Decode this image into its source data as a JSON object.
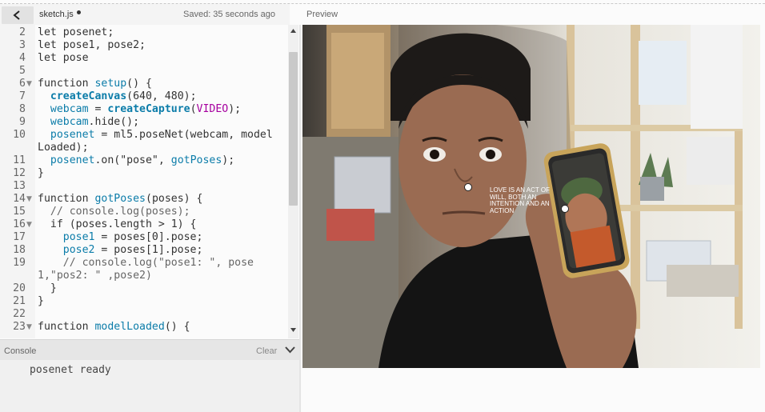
{
  "editor": {
    "file_name": "sketch.js",
    "saved_status": "Saved: 35 seconds ago",
    "code_lines": [
      {
        "n": "2",
        "fold": false,
        "segments": [
          {
            "t": "let posenet;",
            "c": "c-kw"
          }
        ]
      },
      {
        "n": "3",
        "fold": false,
        "segments": [
          {
            "t": "let pose1, pose2;",
            "c": "c-kw"
          }
        ]
      },
      {
        "n": "4",
        "fold": false,
        "segments": [
          {
            "t": "let pose",
            "c": "c-kw"
          }
        ]
      },
      {
        "n": "5",
        "fold": false,
        "segments": [
          {
            "t": "",
            "c": "c-kw"
          }
        ]
      },
      {
        "n": "6",
        "fold": true,
        "segments": [
          {
            "t": "function ",
            "c": "c-kw"
          },
          {
            "t": "setup",
            "c": "c-fn"
          },
          {
            "t": "() {",
            "c": "c-kw"
          }
        ]
      },
      {
        "n": "7",
        "fold": false,
        "segments": [
          {
            "t": "  ",
            "c": "c-kw"
          },
          {
            "t": "createCanvas",
            "c": "c-bold"
          },
          {
            "t": "(640, 480);",
            "c": "c-kw"
          }
        ]
      },
      {
        "n": "8",
        "fold": false,
        "segments": [
          {
            "t": "  ",
            "c": "c-kw"
          },
          {
            "t": "webcam",
            "c": "c-fn"
          },
          {
            "t": " = ",
            "c": "c-kw"
          },
          {
            "t": "createCapture",
            "c": "c-bold"
          },
          {
            "t": "(",
            "c": "c-kw"
          },
          {
            "t": "VIDEO",
            "c": "c-const"
          },
          {
            "t": ");",
            "c": "c-kw"
          }
        ]
      },
      {
        "n": "9",
        "fold": false,
        "segments": [
          {
            "t": "  ",
            "c": "c-kw"
          },
          {
            "t": "webcam",
            "c": "c-fn"
          },
          {
            "t": ".hide();",
            "c": "c-kw"
          }
        ]
      },
      {
        "n": "10",
        "fold": false,
        "wrap": true,
        "segments": [
          {
            "t": "  ",
            "c": "c-kw"
          },
          {
            "t": "posenet",
            "c": "c-fn"
          },
          {
            "t": " = ml5.poseNet(webcam, modelLoaded);",
            "c": "c-kw"
          }
        ]
      },
      {
        "n": "11",
        "fold": false,
        "segments": [
          {
            "t": "  ",
            "c": "c-kw"
          },
          {
            "t": "posenet",
            "c": "c-fn"
          },
          {
            "t": ".on(\"pose\", ",
            "c": "c-kw"
          },
          {
            "t": "gotPoses",
            "c": "c-fn"
          },
          {
            "t": ");",
            "c": "c-kw"
          }
        ]
      },
      {
        "n": "12",
        "fold": false,
        "segments": [
          {
            "t": "}",
            "c": "c-kw"
          }
        ]
      },
      {
        "n": "13",
        "fold": false,
        "segments": [
          {
            "t": "",
            "c": "c-kw"
          }
        ]
      },
      {
        "n": "14",
        "fold": true,
        "segments": [
          {
            "t": "function ",
            "c": "c-kw"
          },
          {
            "t": "gotPoses",
            "c": "c-fn"
          },
          {
            "t": "(poses) {",
            "c": "c-kw"
          }
        ]
      },
      {
        "n": "15",
        "fold": false,
        "segments": [
          {
            "t": "  // console.log(poses);",
            "c": "c-com"
          }
        ]
      },
      {
        "n": "16",
        "fold": true,
        "segments": [
          {
            "t": "  if (poses.length > 1) {",
            "c": "c-kw"
          }
        ]
      },
      {
        "n": "17",
        "fold": false,
        "segments": [
          {
            "t": "    ",
            "c": "c-kw"
          },
          {
            "t": "pose1",
            "c": "c-fn"
          },
          {
            "t": " = poses[0].pose;",
            "c": "c-kw"
          }
        ]
      },
      {
        "n": "18",
        "fold": false,
        "segments": [
          {
            "t": "    ",
            "c": "c-kw"
          },
          {
            "t": "pose2",
            "c": "c-fn"
          },
          {
            "t": " = poses[1].pose;",
            "c": "c-kw"
          }
        ]
      },
      {
        "n": "19",
        "fold": false,
        "wrap": true,
        "segments": [
          {
            "t": "    // console.log(\"pose1: \", pose1,\"pos2: \" ,pose2)",
            "c": "c-com"
          }
        ]
      },
      {
        "n": "20",
        "fold": false,
        "segments": [
          {
            "t": "  }",
            "c": "c-kw"
          }
        ]
      },
      {
        "n": "21",
        "fold": false,
        "segments": [
          {
            "t": "}",
            "c": "c-kw"
          }
        ]
      },
      {
        "n": "22",
        "fold": false,
        "segments": [
          {
            "t": "",
            "c": "c-kw"
          }
        ]
      },
      {
        "n": "23",
        "fold": true,
        "segments": [
          {
            "t": "function ",
            "c": "c-kw"
          },
          {
            "t": "modelLoaded",
            "c": "c-fn"
          },
          {
            "t": "() {",
            "c": "c-kw"
          }
        ]
      }
    ]
  },
  "preview": {
    "label": "Preview",
    "canvas_text": "LOVE IS AN ACT OF WILL, BOTH AN INTENTION AND AN ACTION"
  },
  "console": {
    "title": "Console",
    "clear_label": "Clear",
    "messages": [
      "posenet ready"
    ]
  },
  "icons": {
    "back": "chevron-left-icon",
    "console_toggle": "chevron-down-icon",
    "scroll_up": "triangle-up-icon",
    "scroll_down": "triangle-down-icon",
    "fold": "triangle-down-icon"
  },
  "colors": {
    "function_name": "#0b7ca9",
    "constant": "#a6009f",
    "comment": "#666666"
  }
}
